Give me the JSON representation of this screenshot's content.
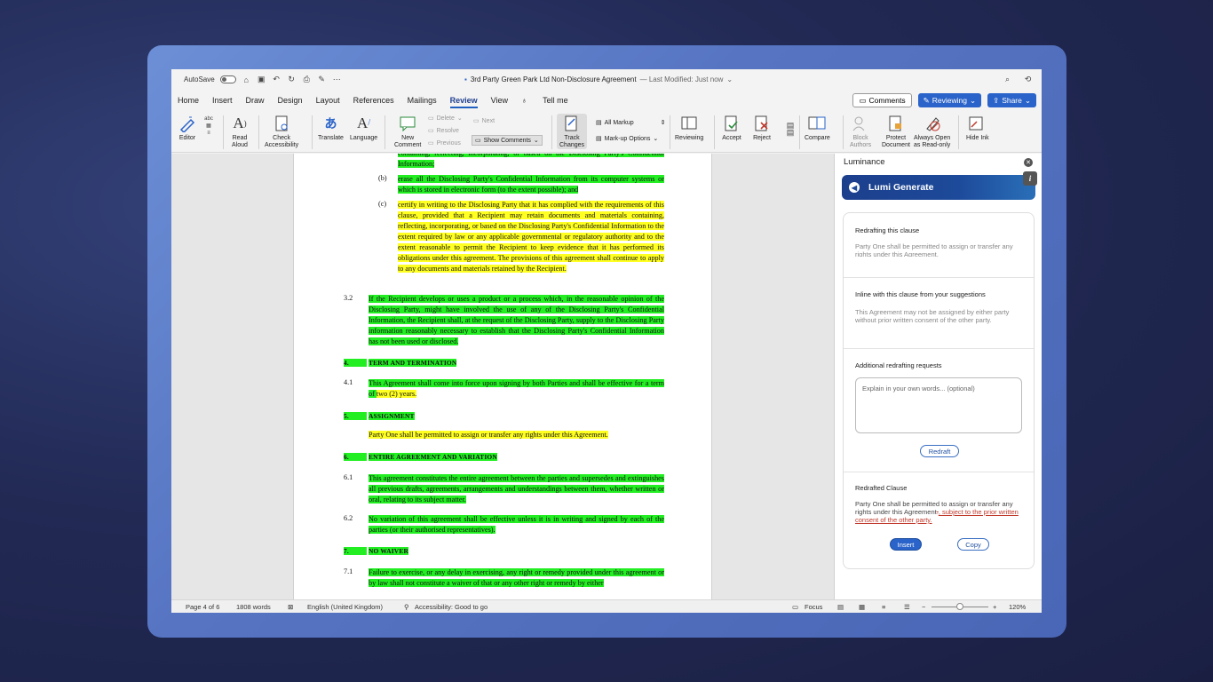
{
  "titlebar": {
    "autosave": "AutoSave",
    "doc_title": "3rd Party Green Park Ltd Non-Disclosure Agreement",
    "modified": "— Last Modified: Just now"
  },
  "menu": {
    "items": [
      "Home",
      "Insert",
      "Draw",
      "Design",
      "Layout",
      "References",
      "Mailings",
      "Review",
      "View",
      "Tell me"
    ],
    "comments": "Comments",
    "reviewing": "Reviewing",
    "share": "Share"
  },
  "ribbon": {
    "editor": "Editor",
    "read_aloud_1": "Read",
    "read_aloud_2": "Aloud",
    "check_1": "Check",
    "check_2": "Accessibility",
    "translate": "Translate",
    "language": "Language",
    "new_comment_1": "New",
    "new_comment_2": "Comment",
    "delete": "Delete",
    "resolve": "Resolve",
    "previous": "Previous",
    "next": "Next",
    "show_comments": "Show Comments",
    "track_1": "Track",
    "track_2": "Changes",
    "all_markup": "All Markup",
    "markup_options": "Mark-up Options",
    "reviewing": "Reviewing",
    "accept": "Accept",
    "reject": "Reject",
    "compare": "Compare",
    "block_1": "Block",
    "block_2": "Authors",
    "protect_1": "Protect",
    "protect_2": "Document",
    "always_1": "Always Open",
    "always_2": "as Read-only",
    "hide_ink": "Hide Ink"
  },
  "document": {
    "top_partial": "containing, reflecting, incorporating, or based on the Disclosing Party's Confidential Information;",
    "b_num": "(b)",
    "b_text": "erase all the Disclosing Party's Confidential Information from its computer systems or which is stored in electronic form (to the extent possible); and",
    "c_num": "(c)",
    "c_text": "certify in writing to the Disclosing Party that it has complied with the requirements of this clause, provided that a Recipient may retain documents and materials containing, reflecting, incorporating, or based on the Disclosing Party's Confidential Information to the extent required by law or any applicable governmental or regulatory authority and to the extent reasonable to permit the Recipient to keep evidence that it has performed its obligations under this agreement. The provisions of this agreement shall continue to apply to any documents and materials retained by the Recipient.",
    "n32": "3.2",
    "t32": "If the Recipient develops or uses a product or a process which, in the reasonable opinion of the Disclosing Party, might have involved the use of any of the Disclosing Party's Confidential Information, the Recipient shall, at the request of the Disclosing Party, supply to the Disclosing Party information reasonably necessary to establish that the Disclosing Party's Confidential Information has not been used or disclosed.",
    "n4": "4.",
    "h4": "TERM AND TERMINATION",
    "n41": "4.1",
    "t41a": "This Agreement shall come into force upon signing by both Parties and shall be effective for a term of ",
    "t41b": "two (2) years.",
    "n5": "5.",
    "h5": "ASSIGNMENT",
    "t5": "Party One shall be permitted to assign or transfer any rights under this Agreement.",
    "n6": "6.",
    "h6": "ENTIRE AGREEMENT AND VARIATION",
    "n61": "6.1",
    "t61": "This agreement constitutes the entire agreement between the parties and supersedes and extinguishes all previous drafts, agreements, arrangements and understandings between them, whether written or oral, relating to its subject matter.",
    "n62": "6.2",
    "t62": "No variation of this agreement shall be effective unless it is in writing and signed by each of the parties (or their authorised representatives).",
    "n7": "7.",
    "h7": "NO WAIVER",
    "n71": "7.1",
    "t71": "Failure to exercise, or any delay in exercising, any right or remedy provided under this agreement or by law shall not constitute a waiver of that or any other right or remedy by either"
  },
  "panel": {
    "title": "Luminance",
    "header": "Lumi Generate",
    "s1_title": "Redrafting this clause",
    "s1_body": "Party One shall be permitted to assign or transfer any rights under this Agreement.",
    "s2_title": "Inline with this clause from your suggestions",
    "s2_body": "This Agreement may not be assigned by either party without prior written consent of the other party.",
    "s3_title": "Additional redrafting requests",
    "placeholder": "Explain in your own words... (optional)",
    "redraft": "Redraft",
    "s4_title": "Redrafted Clause",
    "s4_body": "Party One shall be permitted to assign or transfer any rights under this Agreement",
    "s4_del": ".",
    "s4_add": ", subject to the prior written consent of the other party.",
    "insert": "Insert",
    "copy": "Copy"
  },
  "status": {
    "page": "Page 4 of 6",
    "words": "1808 words",
    "lang": "English (United Kingdom)",
    "access": "Accessibility: Good to go",
    "focus": "Focus",
    "zoom": "120%"
  },
  "colors": {
    "highlight_green": "#22ee22",
    "highlight_yellow": "#ffff22",
    "accent_blue": "#2a63c9"
  }
}
